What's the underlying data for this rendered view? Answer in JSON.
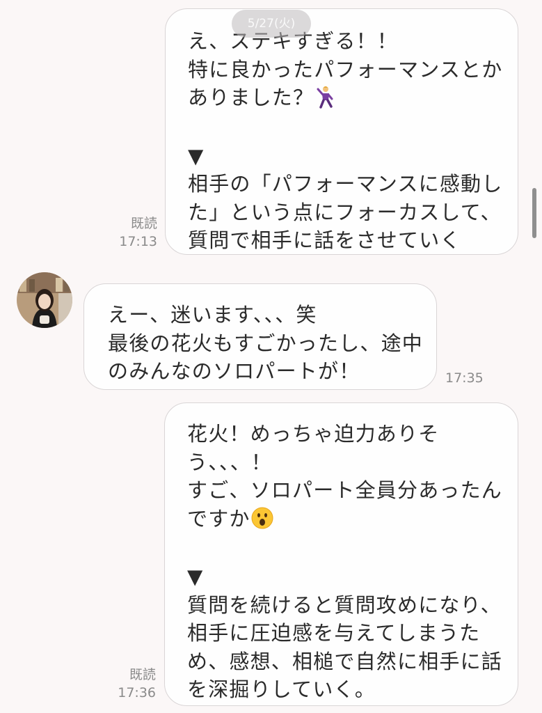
{
  "date_separator": "5/27(火)",
  "messages": [
    {
      "sender": "self",
      "lines": [
        "え、ステキすぎる！！",
        "特に良かったパフォーマンスとか",
        "ありました？"
      ],
      "emoji": "dancing-man-icon",
      "note_marker": "▼",
      "note_lines": [
        "相手の「パフォーマンスに感動し",
        "た」という点にフォーカスして、",
        "質問で相手に話をさせていく"
      ],
      "read_label": "既読",
      "time": "17:13"
    },
    {
      "sender": "other",
      "lines": [
        "えー、迷います、、、笑",
        "最後の花火もすごかったし、途中",
        "のみんなのソロパートが！"
      ],
      "time": "17:35"
    },
    {
      "sender": "self",
      "lines": [
        "花火！めっちゃ迫力ありそ",
        "う、、、！",
        "すご、ソロパート全員分あったん",
        "ですか"
      ],
      "emoji": "surprised-face-icon",
      "note_marker": "▼",
      "note_lines": [
        "質問を続けると質問攻めになり、",
        "相手に圧迫感を与えてしまうた",
        "め、感想、相槌で自然に相手に話",
        "を深掘りしていく。"
      ],
      "read_label": "既読",
      "time": "17:36"
    }
  ]
}
